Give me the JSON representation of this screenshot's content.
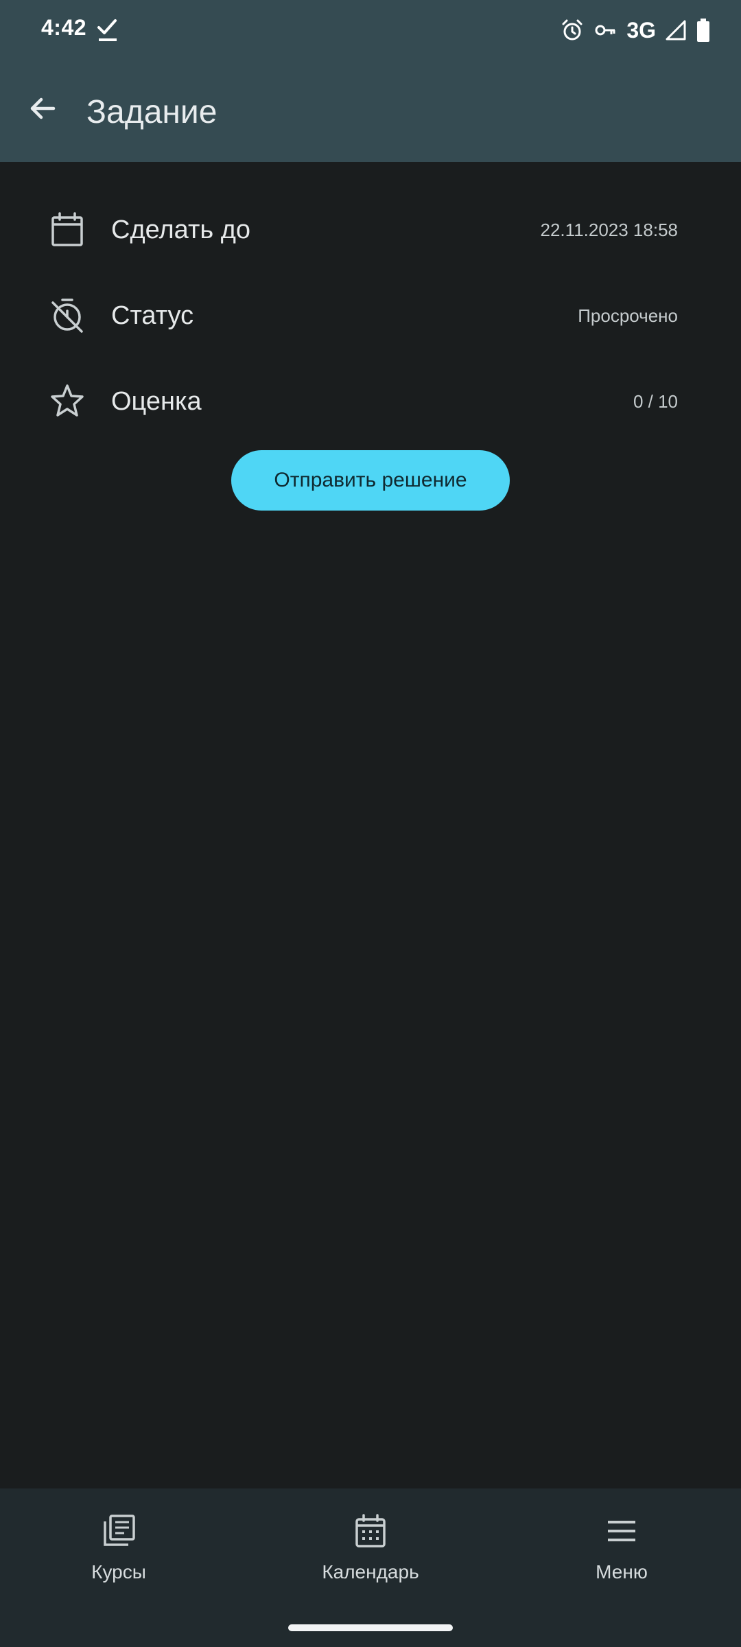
{
  "status_bar": {
    "time": "4:42",
    "network": "3G",
    "icons": [
      "check-icon",
      "alarm-icon",
      "key-icon",
      "signal-icon",
      "battery-icon"
    ]
  },
  "app_bar": {
    "title": "Задание",
    "back_icon": "arrow-back-icon"
  },
  "details": [
    {
      "icon": "calendar-icon",
      "label": "Сделать до",
      "value": "22.11.2023 18:58"
    },
    {
      "icon": "timer-off-icon",
      "label": "Статус",
      "value": "Просрочено"
    },
    {
      "icon": "star-icon",
      "label": "Оценка",
      "value": "0 / 10"
    }
  ],
  "submit_button": {
    "label": "Отправить решение",
    "color": "#4fd6f5"
  },
  "bottom_nav": {
    "items": [
      {
        "icon": "library-books-icon",
        "label": "Курсы"
      },
      {
        "icon": "calendar-month-icon",
        "label": "Календарь"
      },
      {
        "icon": "menu-icon",
        "label": "Меню"
      }
    ]
  },
  "colors": {
    "app_bar": "#354b52",
    "background": "#1a1d1e",
    "bottom_nav": "#212a2e",
    "accent": "#4fd6f5"
  }
}
